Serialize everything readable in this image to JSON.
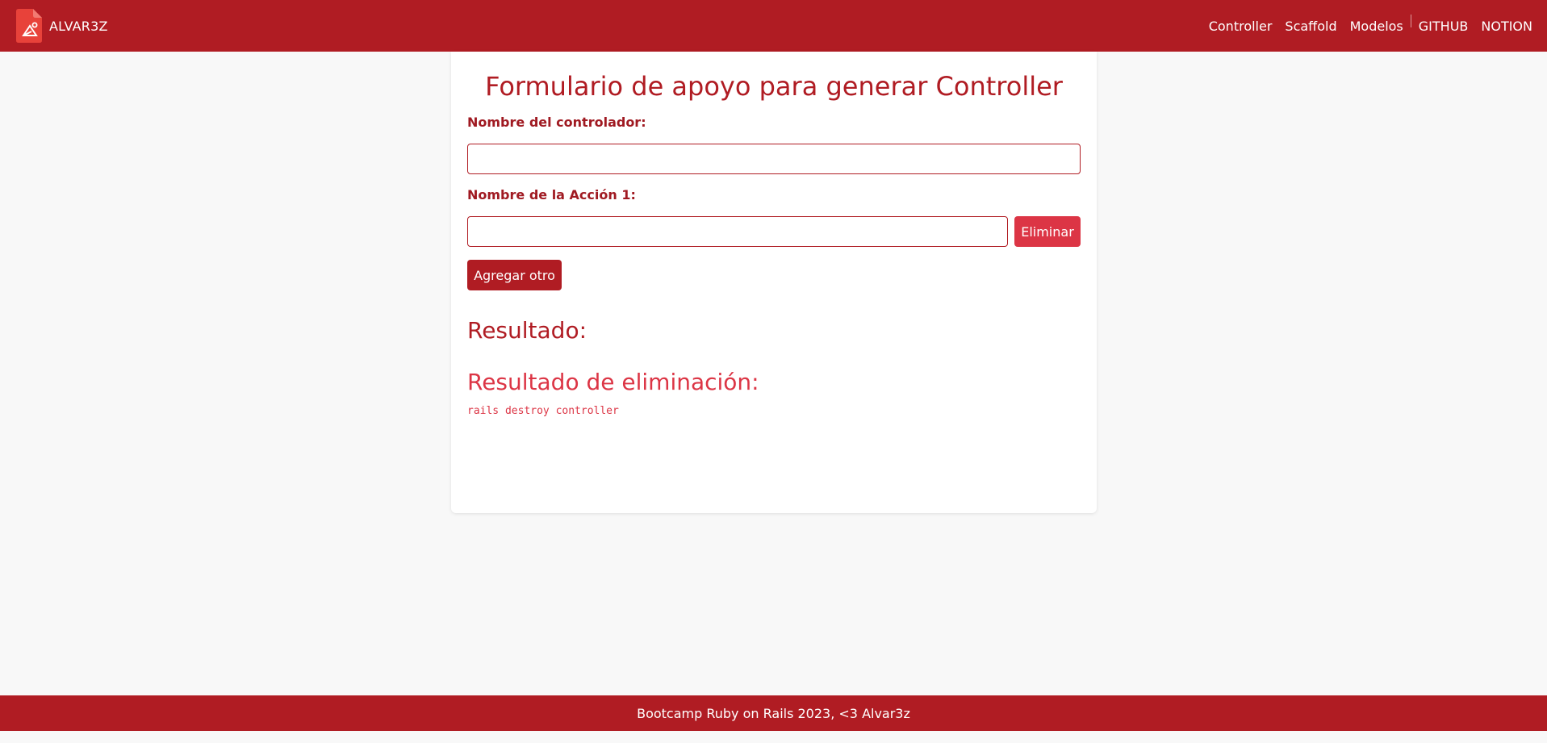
{
  "navbar": {
    "brand": "ALVAR3Z",
    "links": [
      "Controller",
      "Scaffold",
      "Modelos",
      "GITHUB",
      "NOTION"
    ]
  },
  "form": {
    "title": "Formulario de apoyo para generar Controller",
    "controller_label": "Nombre del controlador:",
    "controller_value": "",
    "action_label": "Nombre de la Acción 1:",
    "action_value": "",
    "delete_button": "Eliminar",
    "add_button": "Agregar otro"
  },
  "results": {
    "result_title": "Resultado:",
    "delete_title": "Resultado de eliminación:",
    "delete_command": "rails destroy controller"
  },
  "footer": {
    "text": "Bootcamp Ruby on Rails 2023, <3 Alvar3z"
  },
  "colors": {
    "primary": "#b01c23",
    "danger": "#dc3545",
    "background": "#f8f8f8"
  }
}
